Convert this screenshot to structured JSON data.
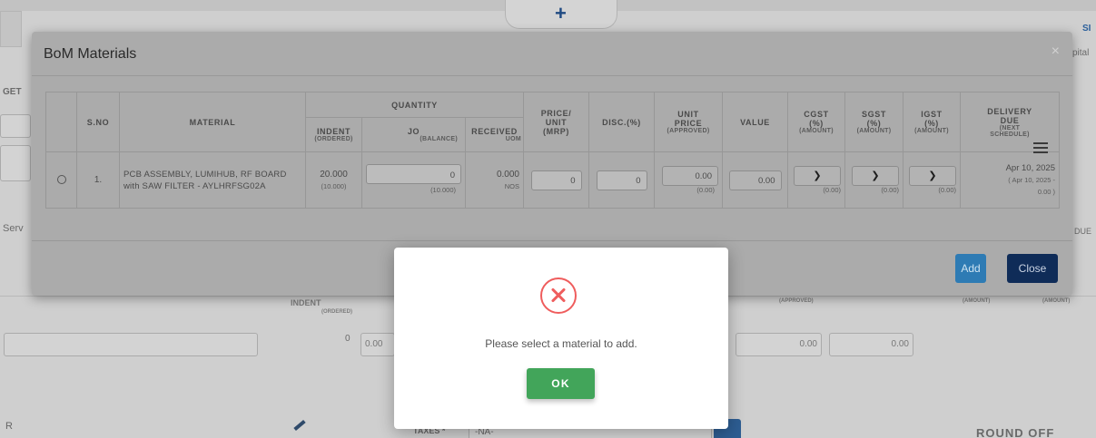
{
  "background": {
    "plus_glyph": "+",
    "edge_texts": [
      "SI",
      "pital",
      "GET",
      "Serv",
      "DUE",
      "INDENT",
      "(ORDERED)",
      "(APPROVED)",
      "(AMOUNT)",
      "(AMOUNT)"
    ],
    "row_values": [
      "0",
      "0.00",
      "0.00",
      "0.00"
    ],
    "bottom_input_value": "R",
    "taxes_label": "TAXES *",
    "taxes_value": "-NA-",
    "round_off_label": "ROUND OFF"
  },
  "bom_modal": {
    "title": "BoM Materials",
    "close_glyph": "×",
    "headers": {
      "sno": "S.NO",
      "material": "MATERIAL",
      "quantity": "QUANTITY",
      "indent": "INDENT",
      "indent_sub": "(ORDERED)",
      "jo": "JO",
      "jo_sub": "(BALANCE)",
      "received": "RECEIVED",
      "received_sub": "UOM",
      "price": "PRICE/",
      "price_2": "UNIT",
      "price_3": "(MRP)",
      "disc": "DISC.(%)",
      "unit_price": "UNIT",
      "unit_price_2": "PRICE",
      "unit_price_sub": "(APPROVED)",
      "value": "VALUE",
      "cgst": "CGST",
      "cgst_2": "(%)",
      "cgst_sub": "(AMOUNT)",
      "sgst": "SGST",
      "sgst_2": "(%)",
      "sgst_sub": "(AMOUNT)",
      "igst": "IGST",
      "igst_2": "(%)",
      "igst_sub": "(AMOUNT)",
      "delivery": "DELIVERY",
      "delivery_2": "DUE",
      "delivery_sub": "(NEXT",
      "delivery_sub2": "SCHEDULE)"
    },
    "rows": [
      {
        "sno": "1.",
        "material_line1": "PCB ASSEMBLY, LUMIHUB, RF BOARD",
        "material_line2": "with SAW FILTER - AYLHRFSG02A",
        "indent": "20.000",
        "indent_sub": "(10.000)",
        "jo_value": "0",
        "jo_sub": "(10.000)",
        "received": "0.000",
        "received_uom": "NOS",
        "price": "0",
        "disc": "0",
        "unit_price": "0.00",
        "unit_price_sub": "(0.00)",
        "value": "0.00",
        "cgst_sub": "(0.00)",
        "sgst_sub": "(0.00)",
        "igst_sub": "(0.00)",
        "delivery": "Apr 10, 2025",
        "delivery_sub": "( Apr 10, 2025 -",
        "delivery_sub2": "0.00 )"
      }
    ],
    "add_label": "Add",
    "close_label": "Close"
  },
  "alert": {
    "message": "Please select a material to add.",
    "ok_label": "OK",
    "icon": "error-circle-x-icon",
    "icon_color": "#ef5d5d",
    "ok_color": "#42a55a"
  }
}
